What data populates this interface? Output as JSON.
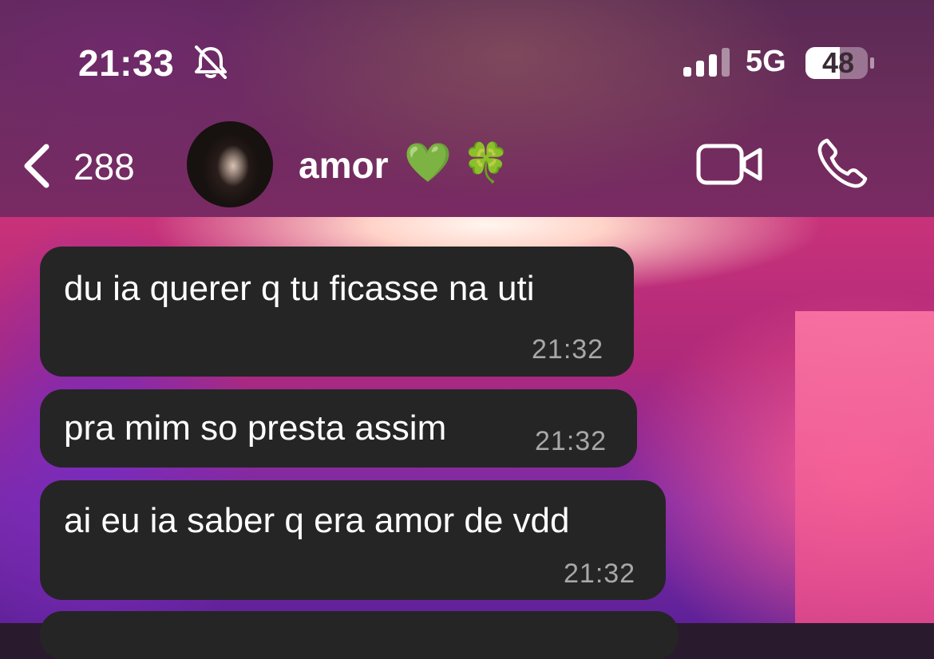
{
  "status_bar": {
    "time": "21:33",
    "network": "5G",
    "battery": "48",
    "icons": [
      "bell-slash-icon",
      "signal-bars-icon",
      "battery-icon"
    ]
  },
  "nav": {
    "back_count": "288",
    "contact_name": "amor",
    "contact_emoji": "💚 🍀",
    "icons": [
      "chevron-left-icon",
      "video-camera-icon",
      "phone-icon"
    ]
  },
  "messages": [
    {
      "text": "du ia querer q tu ficasse na uti",
      "time": "21:32"
    },
    {
      "text": "pra mim so presta assim",
      "time": "21:32"
    },
    {
      "text": "ai eu ia saber q era amor de vdd",
      "time": "21:32"
    }
  ],
  "colors": {
    "bubble": "#252525",
    "timestamp": "#a8a8a8",
    "header": "#6a2d5a",
    "wallpaper_accent": "#c8327a"
  }
}
